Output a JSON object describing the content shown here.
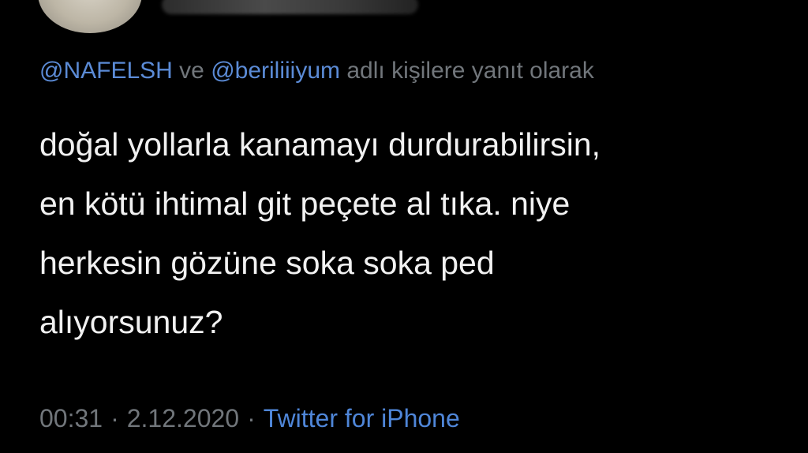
{
  "tweet": {
    "reply_context": {
      "mention_1": "@NAFELSH",
      "joiner": "ve",
      "mention_2": "@beriliiiyum",
      "suffix": "adlı kişilere yanıt olarak"
    },
    "text": "doğal yollarla kanamayı durdurabilirsin,\nen kötü ihtimal git peçete al tıka. niye\nherkesin gözüne soka soka ped\nalıyorsunuz?",
    "time": "00:31",
    "date": "2.12.2020",
    "separator": "·",
    "source": "Twitter for iPhone"
  },
  "colors": {
    "background": "#000000",
    "text": "#f1f1f1",
    "muted": "#71767b",
    "link": "#4f86d8"
  }
}
